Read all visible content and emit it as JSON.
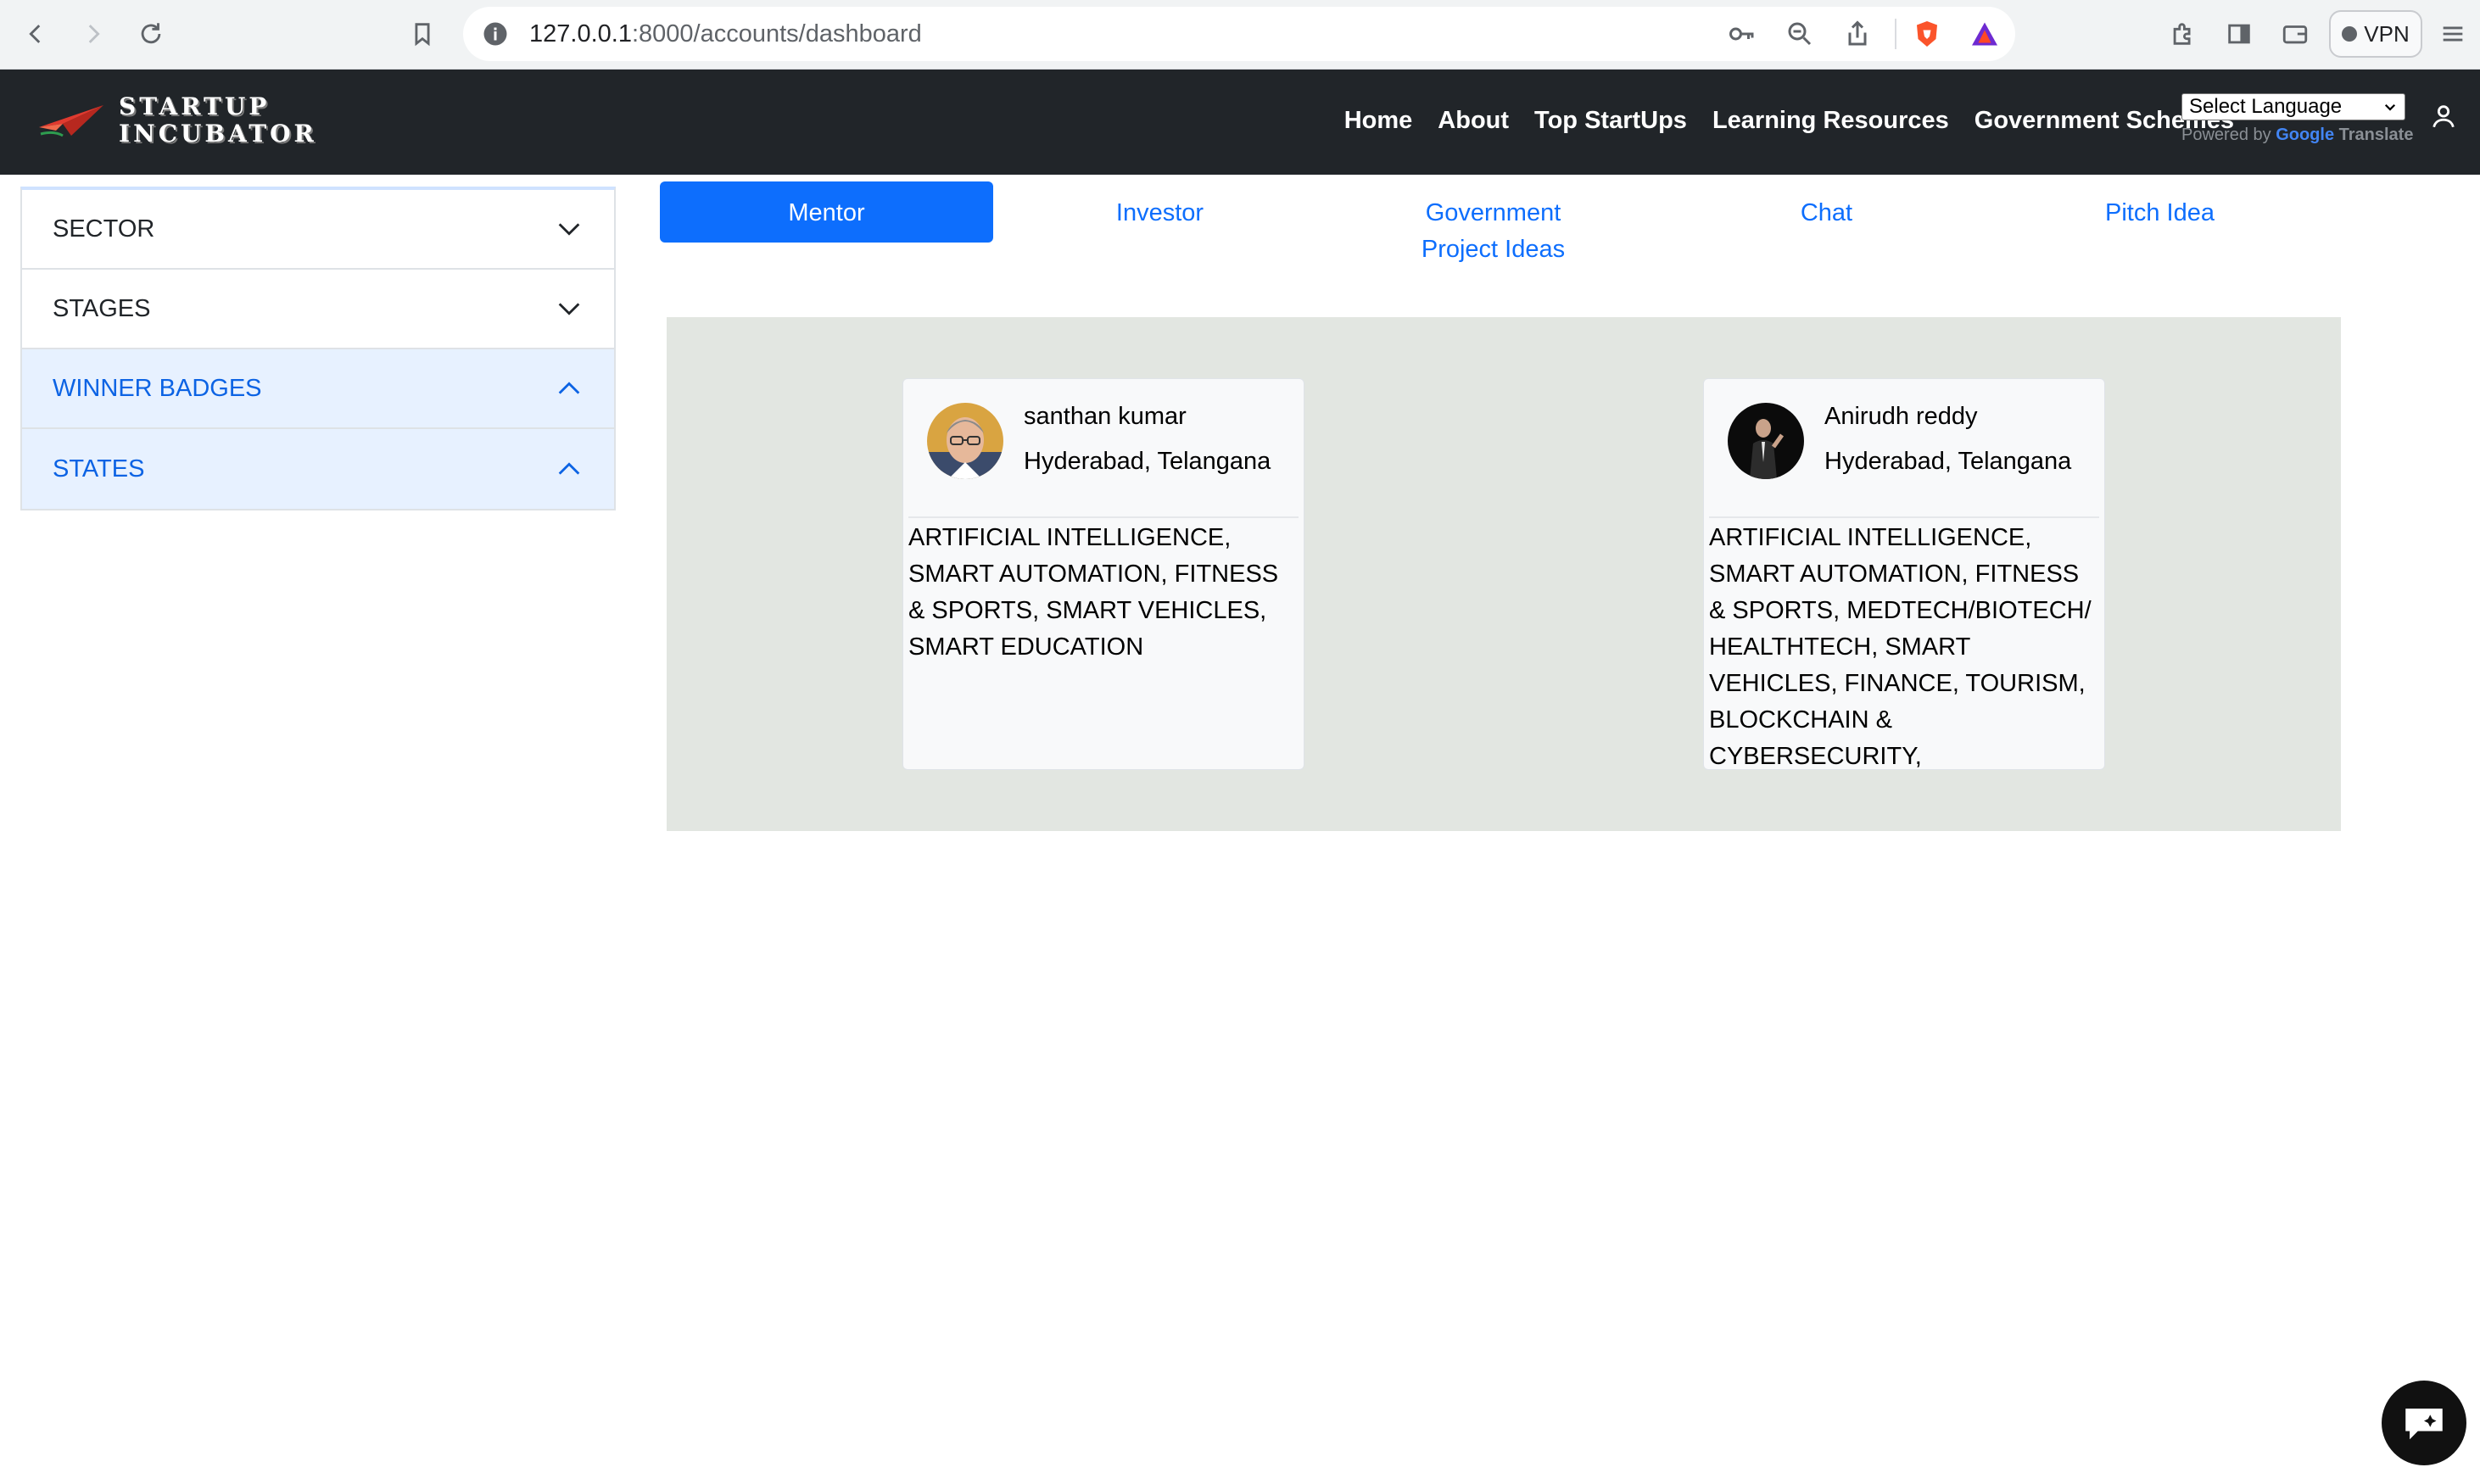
{
  "browser": {
    "url_host": "127.0.0.1",
    "url_path": ":8000/accounts/dashboard",
    "vpn_label": "VPN"
  },
  "navbar": {
    "brand_line1": "STARTUP",
    "brand_line2": "INCUBATOR",
    "links": [
      "Home",
      "About",
      "Top StartUps",
      "Learning Resources",
      "Government Schemes"
    ],
    "language_select": "Select Language",
    "powered_by": "Powered by",
    "google": "Google",
    "translate": "Translate"
  },
  "sidebar": {
    "items": [
      {
        "label": "SECTOR",
        "state": "collapsed"
      },
      {
        "label": "STAGES",
        "state": "collapsed"
      },
      {
        "label": "WINNER BADGES",
        "state": "expanded"
      },
      {
        "label": "STATES",
        "state": "expanded"
      }
    ]
  },
  "tabs": [
    {
      "label": "Mentor",
      "active": true
    },
    {
      "label": "Investor",
      "active": false
    },
    {
      "label": "Government Project Ideas",
      "active": false
    },
    {
      "label": "Chat",
      "active": false
    },
    {
      "label": "Pitch Idea",
      "active": false
    }
  ],
  "mentors": [
    {
      "name": "santhan kumar",
      "location": "Hyderabad, Telangana",
      "sectors": "ARTIFICIAL INTELLIGENCE, SMART AUTOMATION, FITNESS & SPORTS, SMART VEHICLES, SMART EDUCATION"
    },
    {
      "name": "Anirudh reddy",
      "location": "Hyderabad, Telangana",
      "sectors": "ARTIFICIAL INTELLIGENCE, SMART AUTOMATION, FITNESS & SPORTS, MEDTECH/BIOTECH/ HEALTHTECH, SMART VEHICLES, FINANCE, TOURISM, BLOCKCHAIN & CYBERSECURITY,"
    }
  ],
  "colors": {
    "primary": "#0d6efd",
    "navbar_bg": "#212529",
    "panel_bg": "#e2e6e1",
    "accordion_open_bg": "#e7f1ff"
  }
}
